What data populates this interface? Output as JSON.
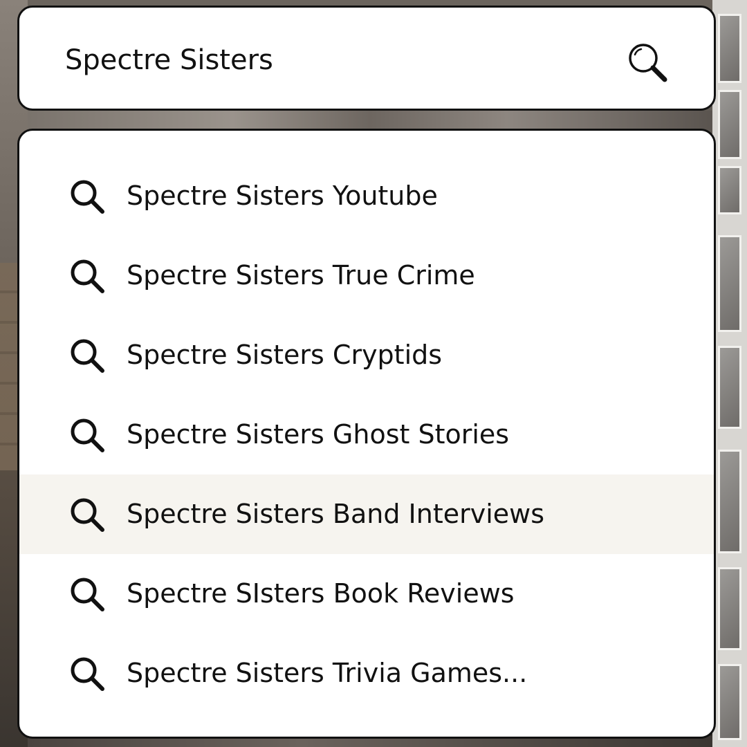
{
  "search": {
    "query": "Spectre Sisters",
    "button_icon": "search-icon"
  },
  "suggestions": [
    {
      "label": "Spectre Sisters Youtube",
      "icon": "search-icon",
      "highlighted": false
    },
    {
      "label": "Spectre Sisters True Crime",
      "icon": "search-icon",
      "highlighted": false
    },
    {
      "label": "Spectre Sisters Cryptids",
      "icon": "search-icon",
      "highlighted": false
    },
    {
      "label": "Spectre Sisters Ghost Stories",
      "icon": "search-icon",
      "highlighted": false
    },
    {
      "label": "Spectre Sisters Band Interviews",
      "icon": "search-icon",
      "highlighted": true
    },
    {
      "label": "Spectre SIsters Book Reviews",
      "icon": "search-icon",
      "highlighted": false
    },
    {
      "label": "Spectre Sisters Trivia Games...",
      "icon": "search-icon",
      "highlighted": false
    }
  ],
  "colors": {
    "box_background": "#ffffff",
    "border": "#111111",
    "text": "#111111",
    "highlight": "#f6f4ef"
  }
}
